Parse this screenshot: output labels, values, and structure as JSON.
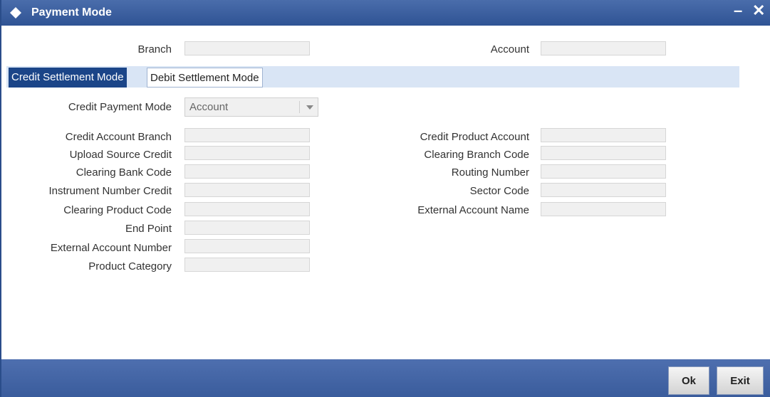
{
  "window": {
    "title": "Payment Mode",
    "minimize_glyph": "–",
    "close_glyph": "✕"
  },
  "header": {
    "branch_label": "Branch",
    "branch_value": "",
    "account_label": "Account",
    "account_value": ""
  },
  "tabs": [
    {
      "label": "Credit Settlement Mode",
      "active": true
    },
    {
      "label": "Debit Settlement Mode",
      "active": false
    }
  ],
  "credit_payment_mode": {
    "label": "Credit Payment Mode",
    "value": "Account"
  },
  "left_fields": [
    {
      "label": "Credit Account Branch",
      "value": ""
    },
    {
      "label": "Upload Source Credit",
      "value": ""
    },
    {
      "label": "Clearing Bank Code",
      "value": ""
    },
    {
      "label": "Instrument Number Credit",
      "value": ""
    },
    {
      "label": "Clearing Product Code",
      "value": ""
    },
    {
      "label": "End Point",
      "value": ""
    },
    {
      "label": "External Account Number",
      "value": ""
    },
    {
      "label": "Product Category",
      "value": ""
    }
  ],
  "right_fields": [
    {
      "label": "Credit Product Account",
      "value": ""
    },
    {
      "label": "Clearing Branch Code",
      "value": ""
    },
    {
      "label": "Routing Number",
      "value": ""
    },
    {
      "label": "Sector Code",
      "value": ""
    },
    {
      "label": "External Account Name",
      "value": ""
    }
  ],
  "footer": {
    "ok_label": "Ok",
    "exit_label": "Exit"
  },
  "colors": {
    "titlebar": "#2f5394",
    "active_tab": "#1b4588",
    "tabbar": "#d9e5f5",
    "footer": "#3a5c9c"
  }
}
